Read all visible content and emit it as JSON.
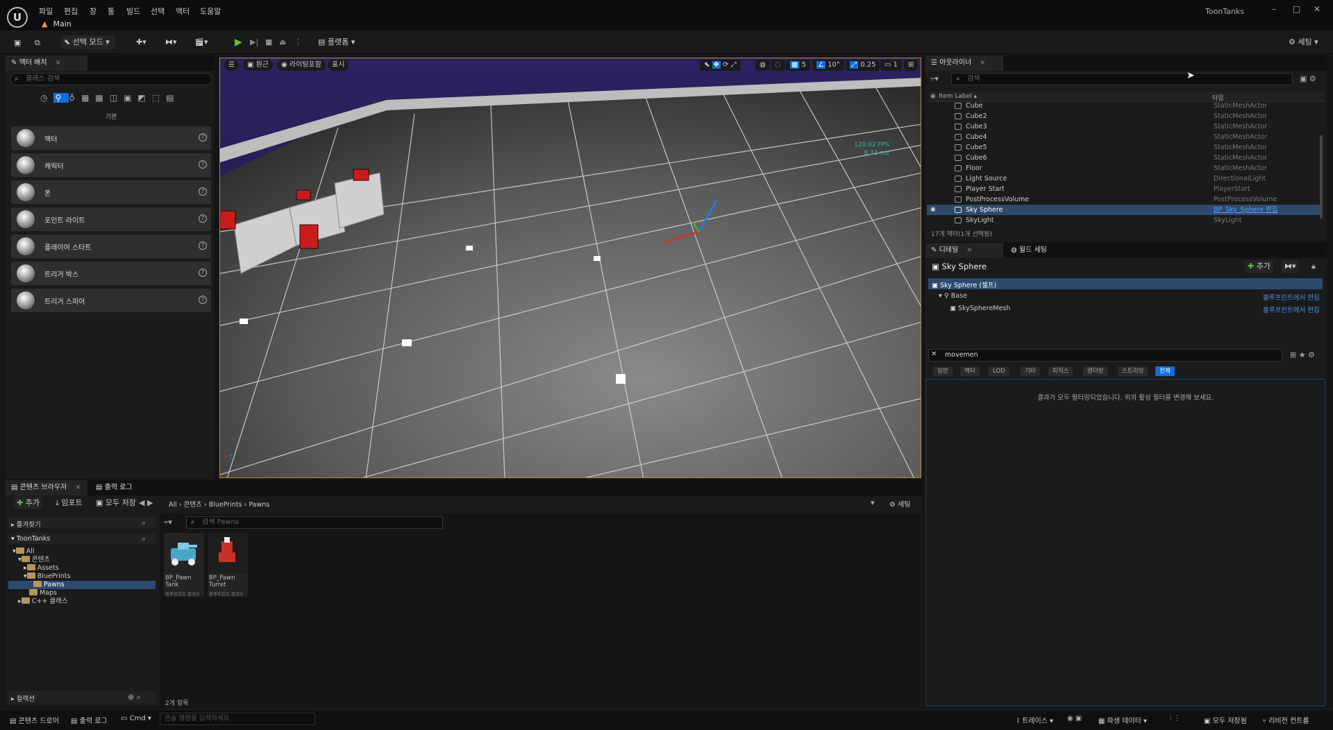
{
  "app": {
    "logo_text": "U",
    "map_name": "Main",
    "project_name": "ToonTanks",
    "menus": [
      "파일",
      "편집",
      "창",
      "툴",
      "빌드",
      "선택",
      "액터",
      "도움말"
    ],
    "window_controls": {
      "minimize": "–",
      "maximize": "□",
      "close": "✕"
    }
  },
  "toolbar": {
    "select_mode": "선택 모드",
    "platform": "플랫폼",
    "settings": "세팅"
  },
  "place_actors": {
    "tab_label": "액터 배치",
    "search_placeholder": "클래스 검색",
    "category": "기본",
    "items": [
      "액터",
      "캐릭터",
      "폰",
      "포인트 라이트",
      "플레이어 스타트",
      "트리거 박스",
      "트리거 스피어"
    ]
  },
  "viewport": {
    "perspective": "원근",
    "view_mode": "라이팅포함",
    "show": "표시",
    "grid_snap": "5",
    "rot_snap": "10°",
    "scale_snap": "0.25",
    "camera_speed": "1",
    "fps": "120.02 FPS",
    "ms": "8.33 ms"
  },
  "outliner": {
    "tab_label": "아웃라이너",
    "search_placeholder": "검색",
    "col_label": "Item Label",
    "col_type": "타입",
    "rows": [
      {
        "name": "Cube",
        "type": "StaticMeshActor"
      },
      {
        "name": "Cube2",
        "type": "StaticMeshActor"
      },
      {
        "name": "Cube3",
        "type": "StaticMeshActor"
      },
      {
        "name": "Cube4",
        "type": "StaticMeshActor"
      },
      {
        "name": "Cube5",
        "type": "StaticMeshActor"
      },
      {
        "name": "Cube6",
        "type": "StaticMeshActor"
      },
      {
        "name": "Floor",
        "type": "StaticMeshActor"
      },
      {
        "name": "Light Source",
        "type": "DirectionalLight"
      },
      {
        "name": "Player Start",
        "type": "PlayerStart"
      },
      {
        "name": "PostProcessVolume",
        "type": "PostProcessVolume"
      },
      {
        "name": "Sky Sphere",
        "type": "BP_Sky_Sphere 편집"
      },
      {
        "name": "SkyLight",
        "type": "SkyLight"
      }
    ],
    "footer": "17개 액터(1개 선택됨)"
  },
  "details": {
    "tab_label": "디테일",
    "tab2_label": "월드 세팅",
    "actor_name": "Sky Sphere",
    "add_button": "추가",
    "root_component": "Sky Sphere (셀프)",
    "base": "Base",
    "mesh": "SkySphereMesh",
    "edit_in_bp": "블루프린트에서 편집",
    "search_value": "movemen",
    "filters": [
      "일반",
      "액터",
      "LOD",
      "기타",
      "피직스",
      "렌더링",
      "스트리밍",
      "전체"
    ],
    "empty_message": "결과가 모두 필터링되었습니다. 위의 활성 필터를 변경해 보세요."
  },
  "content_browser": {
    "tab_label": "콘텐츠 브라우저",
    "tab2_label": "출력 로그",
    "add_button": "추가",
    "import_button": "임포트",
    "save_all_button": "모두 저장",
    "breadcrumb": [
      "All",
      "콘텐츠",
      "BluePrints",
      "Pawns"
    ],
    "settings": "세팅",
    "favorites": "즐겨찾기",
    "project": "ToonTanks",
    "tree": [
      "All",
      "콘텐츠",
      "Assets",
      "BluePrints",
      "Pawns",
      "Maps",
      "C++ 클래스"
    ],
    "asset_search_placeholder": "검색 Pawns",
    "assets": [
      {
        "name": "BP_Pawn Tank",
        "sub": "블루프린트 클래스",
        "thumb_color": "#4aa6c8"
      },
      {
        "name": "BP_Pawn Turret",
        "sub": "블루프린트 클래스",
        "thumb_color": "#c8302b"
      }
    ],
    "item_count": "2개 항목",
    "collections": "컬렉션"
  },
  "statusbar": {
    "content_drawer": "콘텐츠 드로어",
    "output_log": "출력 로그",
    "cmd": "Cmd",
    "console_placeholder": "콘솔 명령을 입력하세요",
    "trace": "트레이스",
    "derived_data": "파생 데이터",
    "all_saved": "모두 저장됨",
    "revision_control": "리비전 컨트롤"
  }
}
